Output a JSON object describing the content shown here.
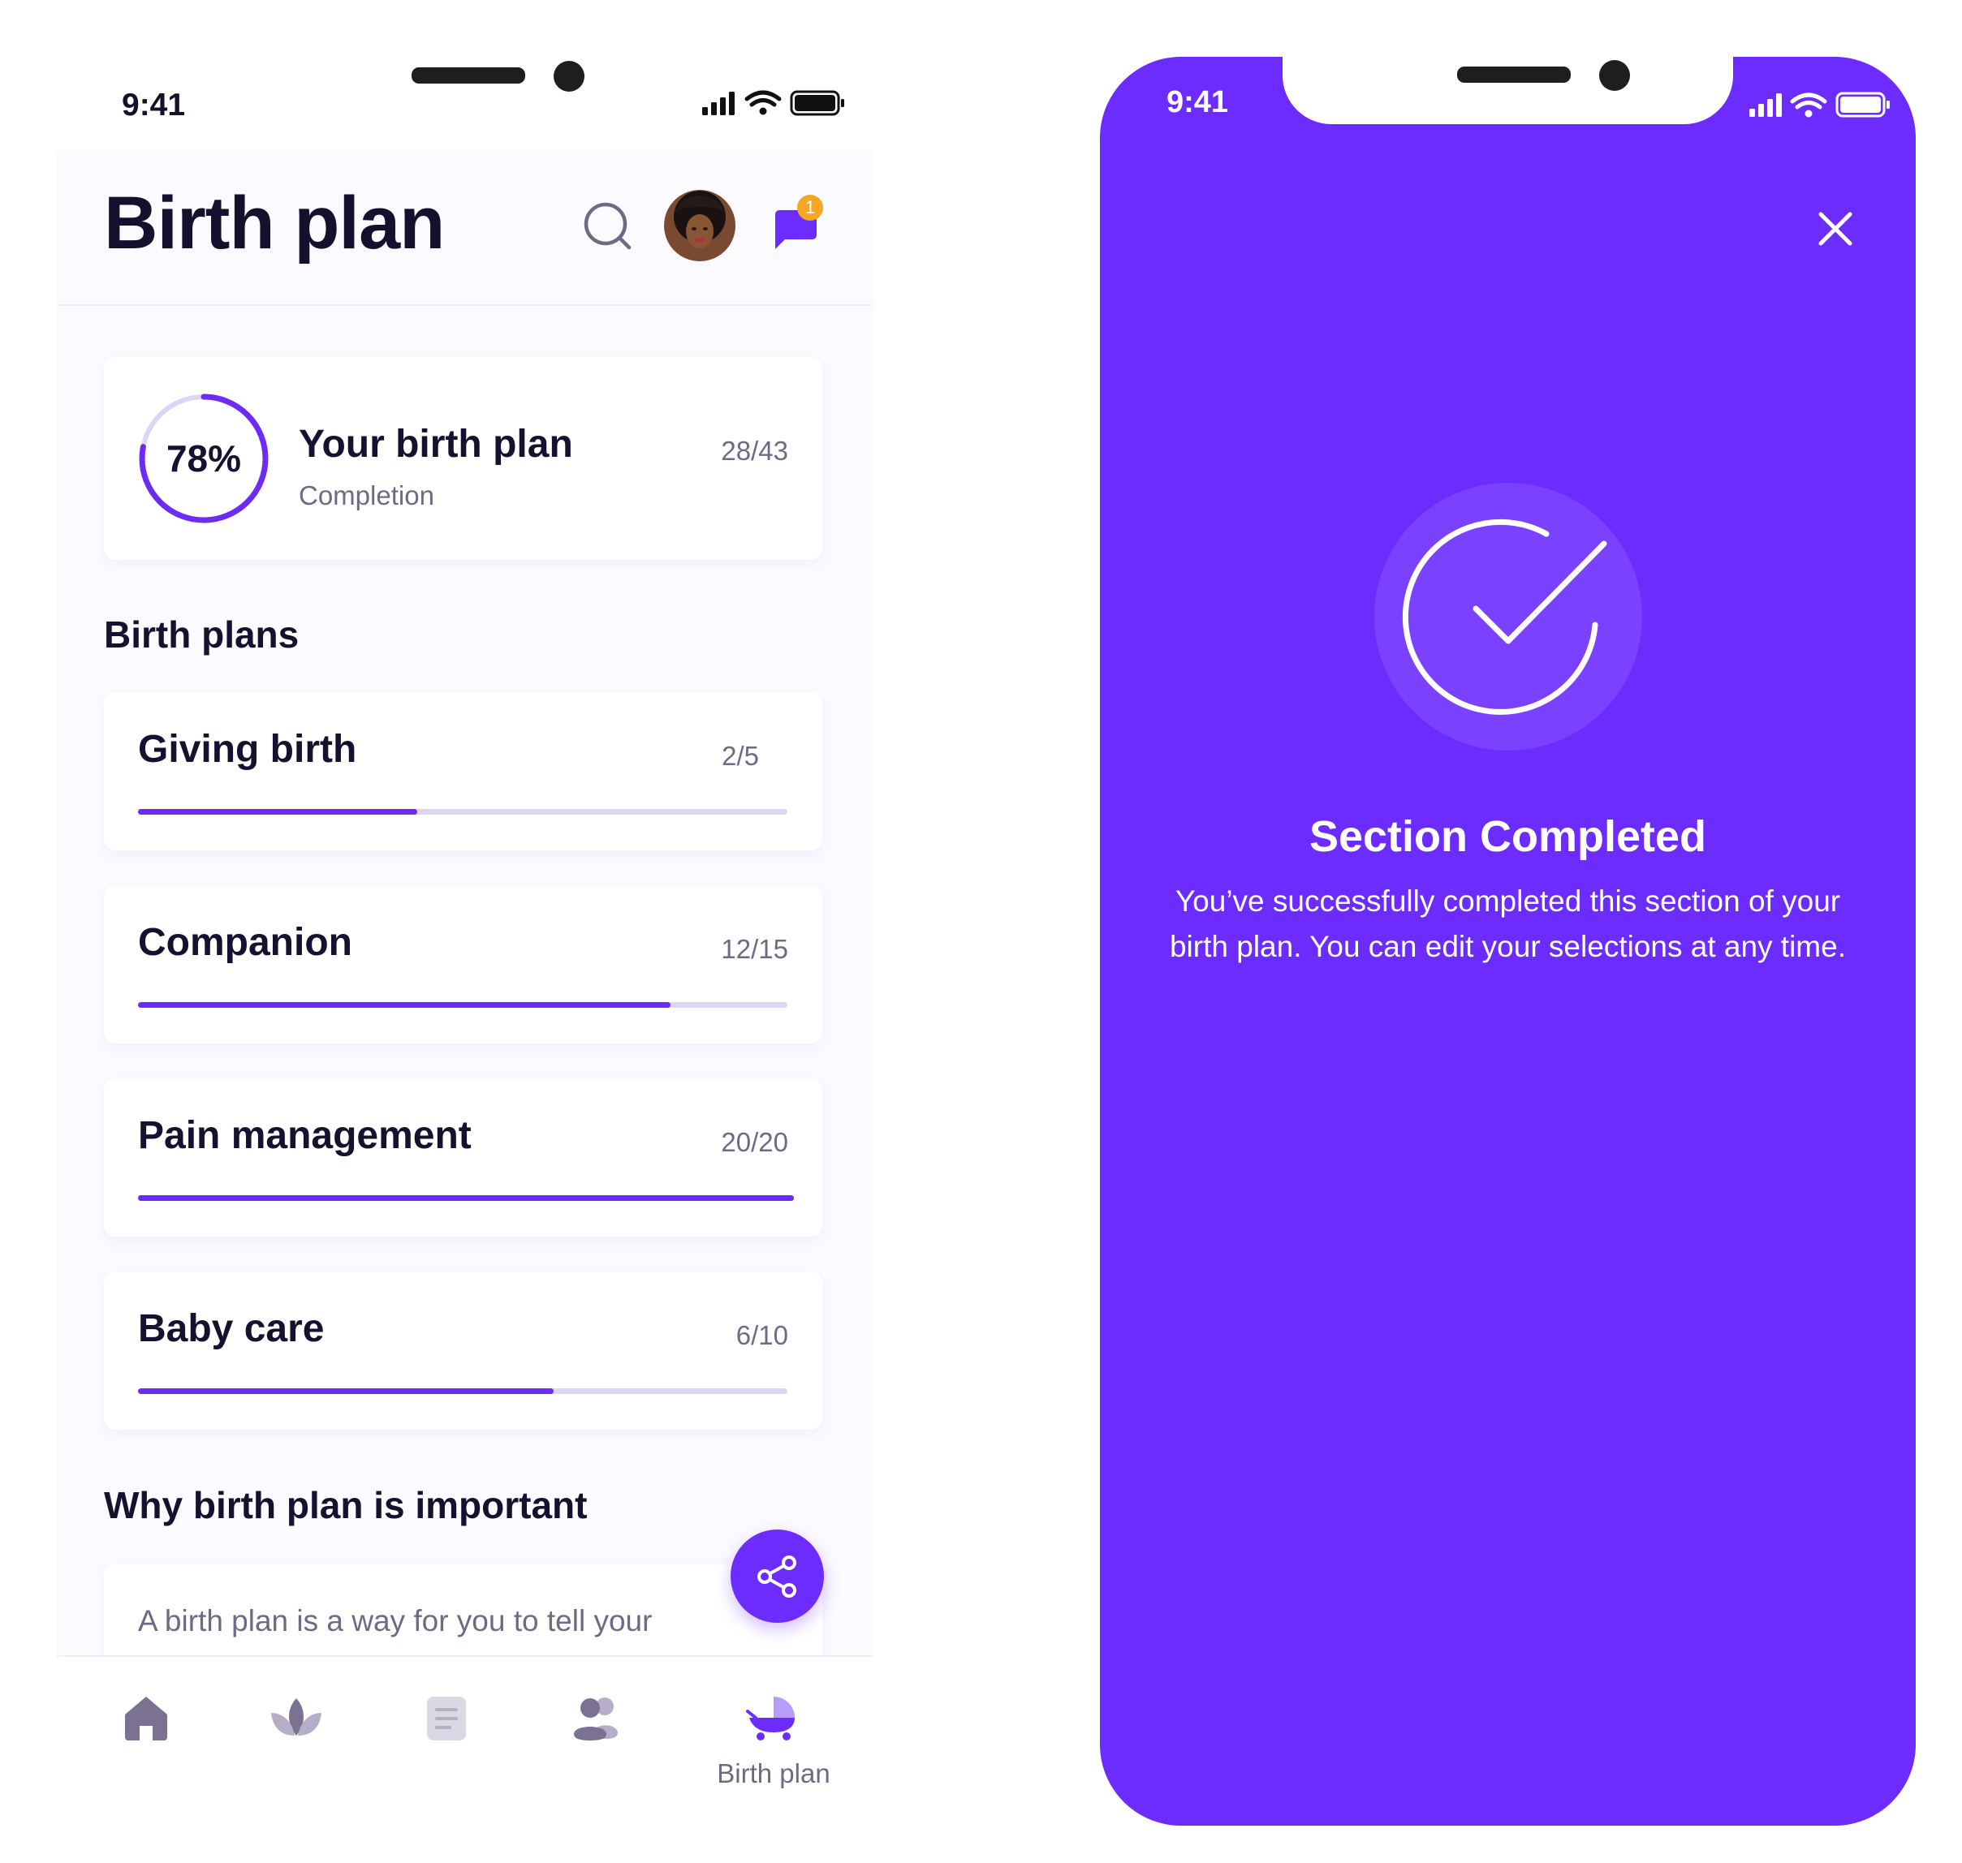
{
  "left": {
    "status_time": "9:41",
    "header": {
      "title": "Birth plan"
    },
    "summary": {
      "percent": "78%",
      "percent_value": 78,
      "title": "Your birth plan",
      "subtitle": "Completion",
      "count": "28/43"
    },
    "plans_heading": "Birth plans",
    "plans": [
      {
        "title": "Giving birth",
        "count": "2/5",
        "progress": 0.43
      },
      {
        "title": "Companion",
        "count": "12/15",
        "progress": 0.82
      },
      {
        "title": "Pain management",
        "count": "20/20",
        "progress": 1.0
      },
      {
        "title": "Baby care",
        "count": "6/10",
        "progress": 0.64
      }
    ],
    "why_heading": "Why birth plan is important",
    "why_text": "A birth plan is a way for you to tell your",
    "notification_badge": "1",
    "nav": {
      "active_label": "Birth plan"
    },
    "icons": [
      "search-icon",
      "avatar",
      "chat-icon",
      "share-icon",
      "home-icon",
      "lotus-icon",
      "document-icon",
      "people-icon",
      "stroller-icon"
    ]
  },
  "right": {
    "status_time": "9:41",
    "title": "Section Completed",
    "message_line1": "You’ve successfully completed this section of your",
    "message_line2": "birth plan. You can edit your selections at any time.",
    "icons": [
      "close-icon",
      "check-circle-icon"
    ]
  },
  "colors": {
    "accent": "#6c2cfe",
    "text_dark": "#14102e",
    "muted": "#6f6a84",
    "badge": "#f5a623"
  }
}
